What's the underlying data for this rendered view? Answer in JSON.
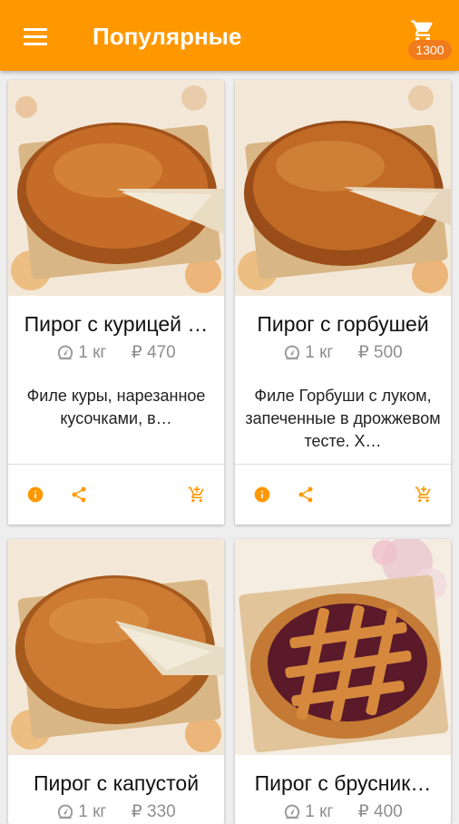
{
  "header": {
    "title": "Популярные",
    "cart_badge": "1300",
    "menu_icon": "hamburger-menu-icon",
    "cart_icon": "shopping-cart-icon"
  },
  "colors": {
    "accent": "#ff9800",
    "icon": "#ff9800",
    "meta": "#8e8e8e"
  },
  "products": [
    {
      "name": "Пирог с курицей …",
      "weight": "1 кг",
      "price": "₽ 470",
      "description": "Филе куры, нарезанное кусочками, в…"
    },
    {
      "name": "Пирог с горбушей",
      "weight": "1 кг",
      "price": "₽ 500",
      "description": "Филе Горбуши с луком, запеченные в дрожжевом тесте. Х…"
    },
    {
      "name": "Пирог с капустой",
      "weight": "1 кг",
      "price": "₽ 330",
      "description": ""
    },
    {
      "name": "Пирог с брусник…",
      "weight": "1 кг",
      "price": "₽ 400",
      "description": ""
    }
  ]
}
